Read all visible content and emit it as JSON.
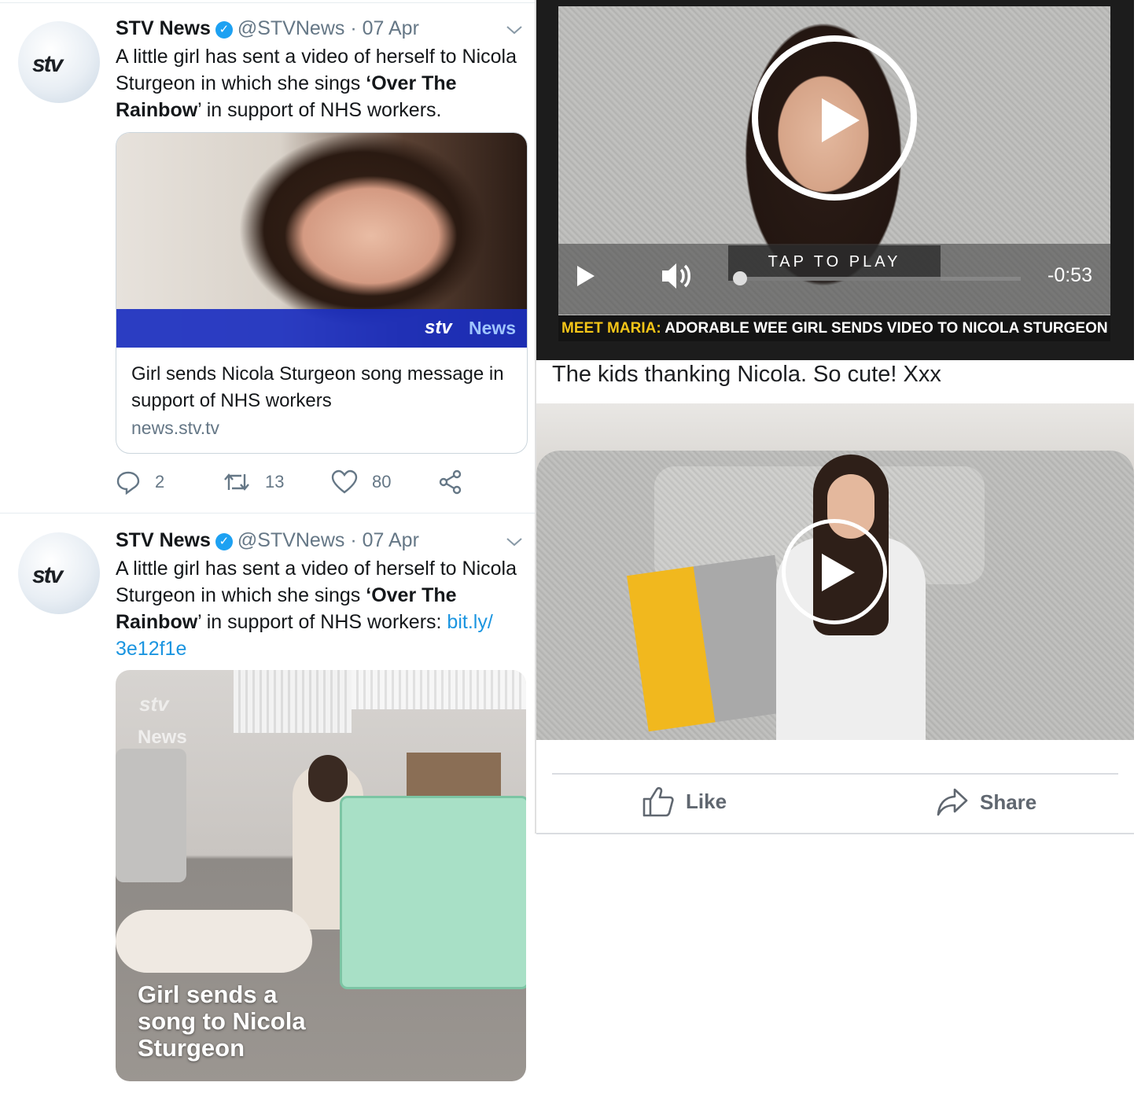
{
  "tweets": [
    {
      "author": "STV News",
      "handle": "@STVNews",
      "date": "· 07 Apr",
      "text_pre": "A little girl has sent a video of herself to Nicola Sturgeon in which she sings ",
      "text_bold": "‘Over The Rainbow",
      "text_post": "’ in support of NHS workers.",
      "card": {
        "brand": "News",
        "title": "Girl sends Nicola Sturgeon song message in support of NHS workers",
        "domain": "news.stv.tv"
      },
      "actions": {
        "replies": "2",
        "retweets": "13",
        "likes": "80"
      }
    },
    {
      "author": "STV News",
      "handle": "@STVNews",
      "date": "· 07 Apr",
      "text_pre": "A little girl has sent a video of herself to Nicola Sturgeon in which she sings ",
      "text_bold": "‘Over The Rainbow",
      "text_post": "’ in support of NHS workers: ",
      "link_a": "bit.ly/",
      "link_b": "3e12f1e",
      "media": {
        "brand": "News",
        "caption_1": "Girl sends a",
        "caption_2": "song to Nicola",
        "caption_3": "Sturgeon"
      }
    }
  ],
  "fb": {
    "video1": {
      "tap_label": "TAP TO PLAY",
      "time": "-0:53",
      "banner_prefix": "MEET MARIA:",
      "banner_text": "ADORABLE WEE GIRL SENDS VIDEO TO NICOLA STURGEON"
    },
    "post_text": "The kids thanking Nicola. So cute! Xxx",
    "like_label": "Like",
    "share_label": "Share"
  },
  "colors": {
    "twitter_blue": "#1da1f2",
    "link": "#1b95e0",
    "stv_band": "#1b2fc0",
    "banner_yellow": "#f4c518"
  }
}
